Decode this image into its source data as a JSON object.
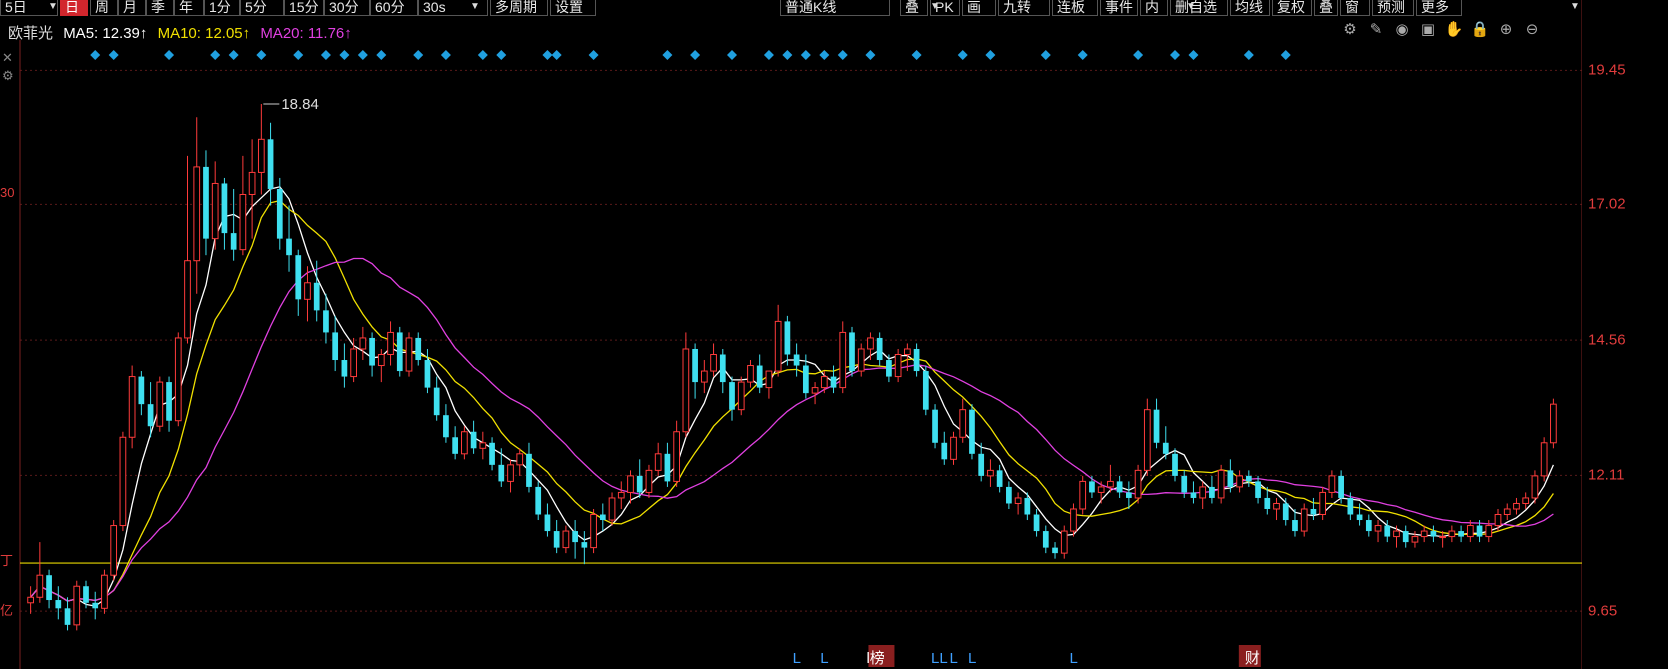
{
  "toolbar": {
    "period_tabs": [
      "5日",
      "日",
      "周",
      "月",
      "季",
      "年",
      "1分",
      "5分",
      "15分",
      "30分",
      "60分",
      "30s",
      "多周期",
      "设置"
    ],
    "active_period": "日",
    "right_tabs": [
      "普通K线",
      "叠",
      "PK",
      "画",
      "九转",
      "连板",
      "事件",
      "内",
      "删自选",
      "均线",
      "复权",
      "叠",
      "窗",
      "预测",
      "更多"
    ]
  },
  "legend": {
    "stock_name": "欧菲光",
    "ma5": "MA5: 12.39↑",
    "ma10": "MA10: 12.05↑",
    "ma20": "MA20: 11.76↑"
  },
  "colors": {
    "background": "#000000",
    "up": "#ff3b3b",
    "down": "#3fe0f0",
    "ma5": "#ffffff",
    "ma10": "#f0e000",
    "ma20": "#e040e0",
    "grid": "#5a1a1a",
    "axis_text": "#e03c3c",
    "marker": "#20a0e0",
    "support_line": "#e8d800"
  },
  "icons": [
    "gear-icon",
    "pen-icon",
    "eye-icon",
    "bag-icon",
    "hand-icon",
    "lock-icon",
    "zoom-in-icon",
    "zoom-out-icon"
  ],
  "left_edge_labels": [
    "30",
    "丁",
    "亿"
  ],
  "chart_data": {
    "type": "candlestick",
    "y_ticks": [
      "19.45",
      "17.02",
      "14.56",
      "12.11",
      "9.65"
    ],
    "ylim": [
      8.6,
      20.0
    ],
    "max_annotation": "18.84",
    "support_level": 10.52,
    "marker_x_indices": [
      7,
      9,
      15,
      20,
      22,
      25,
      29,
      32,
      34,
      36,
      38,
      42,
      45,
      49,
      51,
      56,
      57,
      61,
      69,
      72,
      76,
      80,
      82,
      84,
      86,
      88,
      91,
      96,
      101,
      104,
      110,
      114,
      120,
      124,
      126,
      132,
      136
    ],
    "event_markers": [
      {
        "x_index": 83,
        "label": "L"
      },
      {
        "x_index": 86,
        "label": "L"
      },
      {
        "x_index": 91,
        "label": "l榜"
      },
      {
        "x_index": 98,
        "label": "LL"
      },
      {
        "x_index": 100,
        "label": "L"
      },
      {
        "x_index": 102,
        "label": "L"
      },
      {
        "x_index": 113,
        "label": "L"
      },
      {
        "x_index": 132,
        "label": "财"
      }
    ],
    "ohlc": [
      [
        9.8,
        10.1,
        9.6,
        9.9
      ],
      [
        9.9,
        10.9,
        9.8,
        10.3
      ],
      [
        10.3,
        10.4,
        9.7,
        9.85
      ],
      [
        9.85,
        10.1,
        9.5,
        9.7
      ],
      [
        9.7,
        9.9,
        9.3,
        9.4
      ],
      [
        9.4,
        10.2,
        9.3,
        10.1
      ],
      [
        10.1,
        10.2,
        9.7,
        9.8
      ],
      [
        9.8,
        10.0,
        9.5,
        9.7
      ],
      [
        9.7,
        10.4,
        9.6,
        10.3
      ],
      [
        10.3,
        11.3,
        10.2,
        11.2
      ],
      [
        11.2,
        12.9,
        11.1,
        12.8
      ],
      [
        12.8,
        14.1,
        12.6,
        13.9
      ],
      [
        13.9,
        14.0,
        13.2,
        13.4
      ],
      [
        13.4,
        13.8,
        12.8,
        13.0
      ],
      [
        13.0,
        13.9,
        12.9,
        13.8
      ],
      [
        13.8,
        13.9,
        12.9,
        13.1
      ],
      [
        13.1,
        14.7,
        13.0,
        14.6
      ],
      [
        14.6,
        17.9,
        14.5,
        16.0
      ],
      [
        16.0,
        18.6,
        15.4,
        17.7
      ],
      [
        17.7,
        18.0,
        16.1,
        16.4
      ],
      [
        16.4,
        17.8,
        16.2,
        17.4
      ],
      [
        17.4,
        17.5,
        16.2,
        16.5
      ],
      [
        16.5,
        17.3,
        16.0,
        16.2
      ],
      [
        16.2,
        17.9,
        16.1,
        17.2
      ],
      [
        17.2,
        18.2,
        16.4,
        17.6
      ],
      [
        17.6,
        18.84,
        17.2,
        18.2
      ],
      [
        18.2,
        18.5,
        17.0,
        17.3
      ],
      [
        17.3,
        17.5,
        16.2,
        16.4
      ],
      [
        16.4,
        17.0,
        15.8,
        16.1
      ],
      [
        16.1,
        16.2,
        15.0,
        15.3
      ],
      [
        15.3,
        15.9,
        14.9,
        15.6
      ],
      [
        15.6,
        16.0,
        14.9,
        15.1
      ],
      [
        15.1,
        15.4,
        14.5,
        14.7
      ],
      [
        14.7,
        15.0,
        14.0,
        14.2
      ],
      [
        14.2,
        14.5,
        13.7,
        13.9
      ],
      [
        13.9,
        14.6,
        13.8,
        14.4
      ],
      [
        14.4,
        14.8,
        14.2,
        14.6
      ],
      [
        14.6,
        14.7,
        13.9,
        14.1
      ],
      [
        14.1,
        14.4,
        13.8,
        14.3
      ],
      [
        14.3,
        14.9,
        14.1,
        14.7
      ],
      [
        14.7,
        14.8,
        13.9,
        14.0
      ],
      [
        14.0,
        14.7,
        13.9,
        14.6
      ],
      [
        14.6,
        14.7,
        14.1,
        14.2
      ],
      [
        14.2,
        14.4,
        13.6,
        13.7
      ],
      [
        13.7,
        13.9,
        13.1,
        13.2
      ],
      [
        13.2,
        13.4,
        12.7,
        12.8
      ],
      [
        12.8,
        13.0,
        12.4,
        12.5
      ],
      [
        12.5,
        13.0,
        12.4,
        12.9
      ],
      [
        12.9,
        13.1,
        12.5,
        12.6
      ],
      [
        12.6,
        12.9,
        12.4,
        12.7
      ],
      [
        12.7,
        12.8,
        12.2,
        12.3
      ],
      [
        12.3,
        12.6,
        11.9,
        12.0
      ],
      [
        12.0,
        12.4,
        11.8,
        12.3
      ],
      [
        12.3,
        12.6,
        12.1,
        12.5
      ],
      [
        12.5,
        12.7,
        11.8,
        11.9
      ],
      [
        11.9,
        12.0,
        11.3,
        11.4
      ],
      [
        11.4,
        11.6,
        11.0,
        11.1
      ],
      [
        11.1,
        11.3,
        10.7,
        10.8
      ],
      [
        10.8,
        11.2,
        10.7,
        11.1
      ],
      [
        11.1,
        11.3,
        10.6,
        10.9
      ],
      [
        10.9,
        11.1,
        10.5,
        10.8
      ],
      [
        10.8,
        11.5,
        10.7,
        11.4
      ],
      [
        11.4,
        11.6,
        11.1,
        11.3
      ],
      [
        11.3,
        11.8,
        11.2,
        11.7
      ],
      [
        11.7,
        12.0,
        11.5,
        11.8
      ],
      [
        11.8,
        12.2,
        11.6,
        12.1
      ],
      [
        12.1,
        12.4,
        11.7,
        11.8
      ],
      [
        11.8,
        12.3,
        11.7,
        12.2
      ],
      [
        12.2,
        12.7,
        12.1,
        12.5
      ],
      [
        12.5,
        12.7,
        11.9,
        12.0
      ],
      [
        12.0,
        13.1,
        11.9,
        12.9
      ],
      [
        12.9,
        14.7,
        12.8,
        14.4
      ],
      [
        14.4,
        14.5,
        13.5,
        13.8
      ],
      [
        13.8,
        14.2,
        13.6,
        14.0
      ],
      [
        14.0,
        14.5,
        13.9,
        14.3
      ],
      [
        14.3,
        14.4,
        13.6,
        13.8
      ],
      [
        13.8,
        13.9,
        13.1,
        13.3
      ],
      [
        13.3,
        13.9,
        13.2,
        13.8
      ],
      [
        13.8,
        14.2,
        13.7,
        14.1
      ],
      [
        14.1,
        14.3,
        13.6,
        13.7
      ],
      [
        13.7,
        14.0,
        13.5,
        14.0
      ],
      [
        14.0,
        15.2,
        13.9,
        14.9
      ],
      [
        14.9,
        15.0,
        14.1,
        14.3
      ],
      [
        14.3,
        14.5,
        13.9,
        14.1
      ],
      [
        14.1,
        14.3,
        13.5,
        13.6
      ],
      [
        13.6,
        13.8,
        13.4,
        13.7
      ],
      [
        13.7,
        14.0,
        13.6,
        13.9
      ],
      [
        13.9,
        14.1,
        13.6,
        13.7
      ],
      [
        13.7,
        14.9,
        13.6,
        14.7
      ],
      [
        14.7,
        14.8,
        13.9,
        14.0
      ],
      [
        14.0,
        14.5,
        13.9,
        14.4
      ],
      [
        14.4,
        14.7,
        14.2,
        14.6
      ],
      [
        14.6,
        14.7,
        14.1,
        14.2
      ],
      [
        14.2,
        14.3,
        13.8,
        13.9
      ],
      [
        13.9,
        14.4,
        13.8,
        14.3
      ],
      [
        14.3,
        14.5,
        14.0,
        14.4
      ],
      [
        14.4,
        14.5,
        13.9,
        14.0
      ],
      [
        14.0,
        14.1,
        13.2,
        13.3
      ],
      [
        13.3,
        13.4,
        12.6,
        12.7
      ],
      [
        12.7,
        12.9,
        12.3,
        12.4
      ],
      [
        12.4,
        12.9,
        12.3,
        12.8
      ],
      [
        12.8,
        13.5,
        12.7,
        13.3
      ],
      [
        13.3,
        13.4,
        12.4,
        12.5
      ],
      [
        12.5,
        12.7,
        12.0,
        12.1
      ],
      [
        12.1,
        12.4,
        11.9,
        12.2
      ],
      [
        12.2,
        12.3,
        11.8,
        11.9
      ],
      [
        11.9,
        12.0,
        11.5,
        11.6
      ],
      [
        11.6,
        11.8,
        11.4,
        11.7
      ],
      [
        11.7,
        11.8,
        11.3,
        11.4
      ],
      [
        11.4,
        11.5,
        11.0,
        11.1
      ],
      [
        11.1,
        11.2,
        10.7,
        10.8
      ],
      [
        10.8,
        10.9,
        10.6,
        10.7
      ],
      [
        10.7,
        11.2,
        10.6,
        11.1
      ],
      [
        11.1,
        11.6,
        11.0,
        11.5
      ],
      [
        11.5,
        12.1,
        11.4,
        12.0
      ],
      [
        12.0,
        12.1,
        11.7,
        11.8
      ],
      [
        11.8,
        12.0,
        11.6,
        11.9
      ],
      [
        11.9,
        12.3,
        11.8,
        12.0
      ],
      [
        12.0,
        12.1,
        11.7,
        11.8
      ],
      [
        11.8,
        12.0,
        11.5,
        11.7
      ],
      [
        11.7,
        12.3,
        11.6,
        12.2
      ],
      [
        12.2,
        13.5,
        12.1,
        13.3
      ],
      [
        13.3,
        13.5,
        12.6,
        12.7
      ],
      [
        12.7,
        13.0,
        12.4,
        12.5
      ],
      [
        12.5,
        12.6,
        12.0,
        12.1
      ],
      [
        12.1,
        12.2,
        11.7,
        11.8
      ],
      [
        11.8,
        12.0,
        11.6,
        11.7
      ],
      [
        11.7,
        12.0,
        11.5,
        11.9
      ],
      [
        11.9,
        12.1,
        11.6,
        11.7
      ],
      [
        11.7,
        12.3,
        11.6,
        12.2
      ],
      [
        12.2,
        12.4,
        11.8,
        11.9
      ],
      [
        11.9,
        12.2,
        11.8,
        12.1
      ],
      [
        12.1,
        12.2,
        11.9,
        12.0
      ],
      [
        12.0,
        12.1,
        11.6,
        11.7
      ],
      [
        11.7,
        11.9,
        11.4,
        11.5
      ],
      [
        11.5,
        11.7,
        11.3,
        11.6
      ],
      [
        11.6,
        11.7,
        11.2,
        11.3
      ],
      [
        11.3,
        11.5,
        11.0,
        11.1
      ],
      [
        11.1,
        11.6,
        11.0,
        11.5
      ],
      [
        11.5,
        11.7,
        11.3,
        11.4
      ],
      [
        11.4,
        11.9,
        11.3,
        11.8
      ],
      [
        11.8,
        12.2,
        11.7,
        12.1
      ],
      [
        12.1,
        12.2,
        11.6,
        11.7
      ],
      [
        11.7,
        11.8,
        11.3,
        11.4
      ],
      [
        11.4,
        11.6,
        11.2,
        11.3
      ],
      [
        11.3,
        11.4,
        11.0,
        11.1
      ],
      [
        11.1,
        11.3,
        10.9,
        11.2
      ],
      [
        11.2,
        11.3,
        10.9,
        11.0
      ],
      [
        11.0,
        11.2,
        10.8,
        11.1
      ],
      [
        11.1,
        11.2,
        10.8,
        10.9
      ],
      [
        10.9,
        11.1,
        10.8,
        11.0
      ],
      [
        11.0,
        11.2,
        10.9,
        11.1
      ],
      [
        11.1,
        11.2,
        10.9,
        11.0
      ],
      [
        11.0,
        11.1,
        10.8,
        11.0
      ],
      [
        11.0,
        11.2,
        10.9,
        11.1
      ],
      [
        11.1,
        11.2,
        10.9,
        11.0
      ],
      [
        11.0,
        11.3,
        10.9,
        11.2
      ],
      [
        11.2,
        11.3,
        10.9,
        11.0
      ],
      [
        11.0,
        11.3,
        10.9,
        11.2
      ],
      [
        11.2,
        11.5,
        11.1,
        11.4
      ],
      [
        11.4,
        11.6,
        11.3,
        11.5
      ],
      [
        11.5,
        11.7,
        11.4,
        11.6
      ],
      [
        11.6,
        11.8,
        11.5,
        11.7
      ],
      [
        11.7,
        12.2,
        11.6,
        12.1
      ],
      [
        12.1,
        12.8,
        12.0,
        12.7
      ],
      [
        12.7,
        13.5,
        12.6,
        13.4
      ]
    ]
  }
}
